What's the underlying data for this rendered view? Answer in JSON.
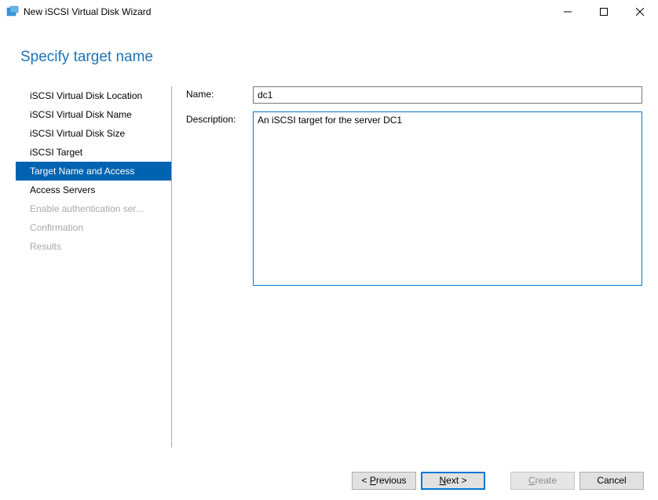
{
  "window": {
    "title": "New iSCSI Virtual Disk Wizard"
  },
  "page": {
    "heading": "Specify target name"
  },
  "steps": {
    "items": [
      {
        "label": "iSCSI Virtual Disk Location",
        "state": "normal"
      },
      {
        "label": "iSCSI Virtual Disk Name",
        "state": "normal"
      },
      {
        "label": "iSCSI Virtual Disk Size",
        "state": "normal"
      },
      {
        "label": "iSCSI Target",
        "state": "normal"
      },
      {
        "label": "Target Name and Access",
        "state": "active"
      },
      {
        "label": "Access Servers",
        "state": "normal"
      },
      {
        "label": "Enable authentication ser...",
        "state": "disabled"
      },
      {
        "label": "Confirmation",
        "state": "disabled"
      },
      {
        "label": "Results",
        "state": "disabled"
      }
    ]
  },
  "form": {
    "name_label": "Name:",
    "name_value": "dc1",
    "description_label": "Description:",
    "description_value": "An iSCSI target for the server DC1"
  },
  "footer": {
    "previous_pre": "< ",
    "previous_ul": "P",
    "previous_post": "revious",
    "next_ul": "N",
    "next_post": "ext >",
    "create_pre": "",
    "create_ul": "C",
    "create_post": "reate",
    "cancel": "Cancel"
  }
}
